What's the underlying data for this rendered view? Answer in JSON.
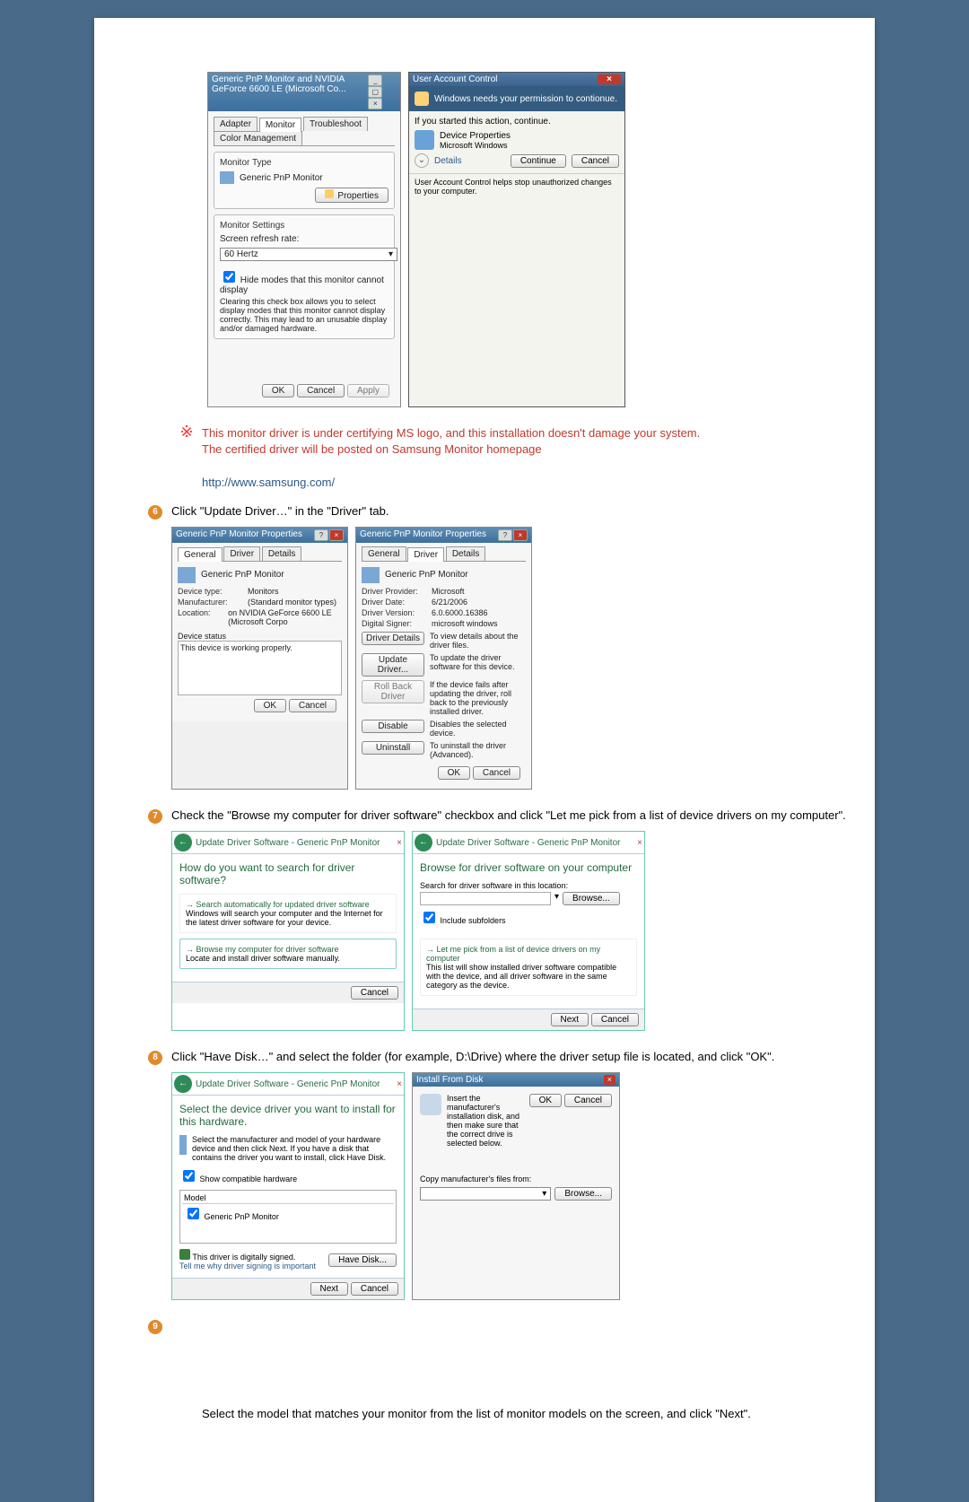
{
  "step5": {
    "monitor_dialog": {
      "title": "Generic PnP Monitor and NVIDIA GeForce 6600 LE (Microsoft Co...",
      "tabs": [
        "Adapter",
        "Monitor",
        "Troubleshoot",
        "Color Management"
      ],
      "monitor_type_label": "Monitor Type",
      "monitor_type_value": "Generic PnP Monitor",
      "properties_btn": "Properties",
      "monitor_settings_label": "Monitor Settings",
      "refresh_rate_label": "Screen refresh rate:",
      "refresh_rate_value": "60 Hertz",
      "hide_modes_label": "Hide modes that this monitor cannot display",
      "hide_modes_desc": "Clearing this check box allows you to select display modes that this monitor cannot display correctly. This may lead to an unusable display and/or damaged hardware.",
      "ok": "OK",
      "cancel": "Cancel",
      "apply": "Apply"
    },
    "uac": {
      "title": "User Account Control",
      "need_permission": "Windows needs your permission to contionue.",
      "if_started": "If you started this action, continue.",
      "device_properties": "Device Properties",
      "ms_windows": "Microsoft Windows",
      "details": "Details",
      "continue": "Continue",
      "cancel": "Cancel",
      "helps_stop": "User Account Control helps stop unauthorized changes to your computer."
    },
    "note1": "This monitor driver is under certifying MS logo, and this installation doesn't damage your system.",
    "note2": "The certified driver will be posted on Samsung Monitor homepage",
    "url": "http://www.samsung.com/"
  },
  "step6": {
    "bullet": "6",
    "instruction": "Click \"Update Driver…\" in the \"Driver\" tab.",
    "left": {
      "title": "Generic PnP Monitor Properties",
      "tabs": [
        "General",
        "Driver",
        "Details"
      ],
      "name": "Generic PnP Monitor",
      "device_type_k": "Device type:",
      "device_type_v": "Monitors",
      "manufacturer_k": "Manufacturer:",
      "manufacturer_v": "(Standard monitor types)",
      "location_k": "Location:",
      "location_v": "on NVIDIA GeForce 6600 LE (Microsoft Corpo",
      "device_status_k": "Device status",
      "device_status_v": "This device is working properly.",
      "ok": "OK",
      "cancel": "Cancel"
    },
    "right": {
      "title": "Generic PnP Monitor Properties",
      "tabs": [
        "General",
        "Driver",
        "Details"
      ],
      "name": "Generic PnP Monitor",
      "provider_k": "Driver Provider:",
      "provider_v": "Microsoft",
      "date_k": "Driver Date:",
      "date_v": "6/21/2006",
      "version_k": "Driver Version:",
      "version_v": "6.0.6000.16386",
      "signer_k": "Digital Signer:",
      "signer_v": "microsoft windows",
      "driver_details_btn": "Driver Details",
      "driver_details_desc": "To view details about the driver files.",
      "update_btn": "Update Driver...",
      "update_desc": "To update the driver software for this device.",
      "rollback_btn": "Roll Back Driver",
      "rollback_desc": "If the device fails after updating the driver, roll back to the previously installed driver.",
      "disable_btn": "Disable",
      "disable_desc": "Disables the selected device.",
      "uninstall_btn": "Uninstall",
      "uninstall_desc": "To uninstall the driver (Advanced).",
      "ok": "OK",
      "cancel": "Cancel"
    }
  },
  "step7": {
    "bullet": "7",
    "instruction": "Check the \"Browse my computer for driver software\" checkbox and click \"Let me pick from a list of device drivers on my computer\".",
    "left": {
      "title": "Update Driver Software - Generic PnP Monitor",
      "headline": "How do you want to search for driver software?",
      "opt1_h": "Search automatically for updated driver software",
      "opt1_d": "Windows will search your computer and the Internet for the latest driver software for your device.",
      "opt2_h": "Browse my computer for driver software",
      "opt2_d": "Locate and install driver software manually.",
      "cancel": "Cancel"
    },
    "right": {
      "title": "Update Driver Software - Generic PnP Monitor",
      "headline": "Browse for driver software on your computer",
      "search_label": "Search for driver software in this location:",
      "path_value": "",
      "browse": "Browse...",
      "include_sub": "Include subfolders",
      "opt_h": "Let me pick from a list of device drivers on my computer",
      "opt_d": "This list will show installed driver software compatible with the device, and all driver software in the same category as the device.",
      "next": "Next",
      "cancel": "Cancel"
    }
  },
  "step8": {
    "bullet": "8",
    "instruction": "Click \"Have Disk…\" and select the folder (for example, D:\\Drive) where the driver setup file is located, and click \"OK\".",
    "left": {
      "title": "Update Driver Software - Generic PnP Monitor",
      "headline": "Select the device driver you want to install for this hardware.",
      "sub": "Select the manufacturer and model of your hardware device and then click Next. If you have a disk that contains the driver you want to install, click Have Disk.",
      "show_compat": "Show compatible hardware",
      "model_label": "Model",
      "model_item": "Generic PnP Monitor",
      "signed": "This driver is digitally signed.",
      "tell_why": "Tell me why driver signing is important",
      "have_disk": "Have Disk...",
      "next": "Next",
      "cancel": "Cancel"
    },
    "right": {
      "title": "Install From Disk",
      "msg": "Insert the manufacturer's installation disk, and then make sure that the correct drive is selected below.",
      "ok": "OK",
      "cancel": "Cancel",
      "copy_from": "Copy manufacturer's files from:",
      "combo_value": "",
      "browse": "Browse..."
    }
  },
  "step9": {
    "bullet": "9",
    "instruction": "Select the model that matches your monitor from the list of monitor models on the screen, and click \"Next\"."
  }
}
